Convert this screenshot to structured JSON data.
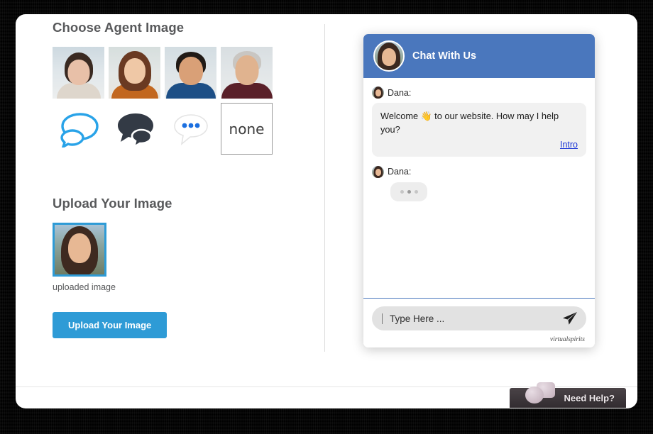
{
  "left_panel": {
    "choose_title": "Choose Agent Image",
    "avatars": [
      {
        "name": "agent-avatar-woman-short-hair",
        "bg": "#dfe6ea",
        "skin": "#e8c0a8",
        "hair": "#3a2a22",
        "clothes": "#ded6cc"
      },
      {
        "name": "agent-avatar-woman-long-hair",
        "bg": "#e3e7e6",
        "skin": "#efc8a6",
        "hair": "#6a3a22",
        "clothes": "#c2671f"
      },
      {
        "name": "agent-avatar-man-dark-hair",
        "bg": "#dfe5e8",
        "skin": "#d9a077",
        "hair": "#211a16",
        "clothes": "#1d4f86"
      },
      {
        "name": "agent-avatar-man-gray-hair",
        "bg": "#e2e6e8",
        "skin": "#e0b38f",
        "hair": "#c9c6c2",
        "clothes": "#5a2029"
      }
    ],
    "icon_options": [
      {
        "name": "chat-bubbles-outline-icon",
        "label": "blue outline speech bubbles"
      },
      {
        "name": "chat-bubbles-filled-icon",
        "label": "dark filled speech bubbles"
      },
      {
        "name": "chat-bubble-dots-icon",
        "label": "white bubble with blue dots"
      },
      {
        "name": "none-option",
        "label": "none"
      }
    ],
    "upload_title": "Upload Your Image",
    "upload_caption": "uploaded image",
    "upload_button": "Upload Your Image"
  },
  "chat": {
    "header_title": "Chat With Us",
    "messages": [
      {
        "sender": "Dana:",
        "text": "Welcome 👋 to our website. How may I help you?",
        "link": "Intro",
        "typing": false
      },
      {
        "sender": "Dana:",
        "text": "",
        "link": "",
        "typing": true
      }
    ],
    "input_placeholder": "Type Here ...",
    "input_value": "",
    "send_icon": "send-paper-plane-icon",
    "brand": "virtualspirits"
  },
  "need_help": {
    "label": "Need Help?"
  },
  "colors": {
    "header_blue": "#4a77bd",
    "accent_blue": "#2e9bd6",
    "link_blue": "#1a35d6",
    "bubble_gray": "#f1f1f1",
    "title_gray": "#58595b"
  }
}
